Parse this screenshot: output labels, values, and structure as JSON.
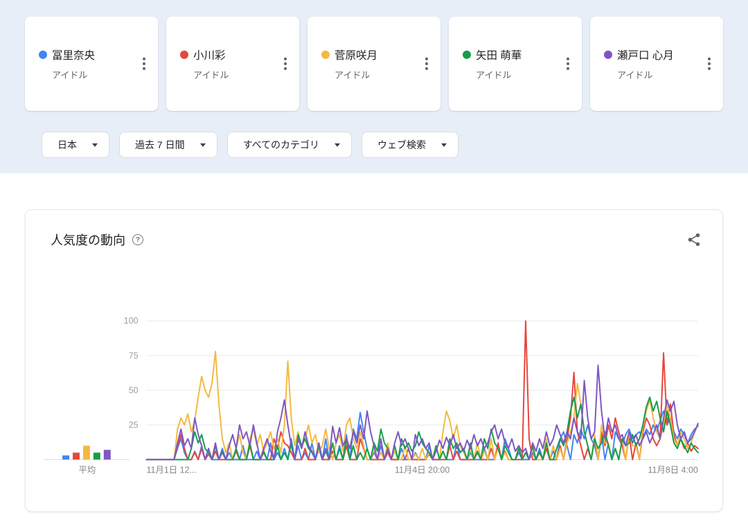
{
  "cards": [
    {
      "name": "冨里奈央",
      "type": "アイドル",
      "color": "#4285f4"
    },
    {
      "name": "小川彩",
      "type": "アイドル",
      "color": "#e8453c"
    },
    {
      "name": "菅原咲月",
      "type": "アイドル",
      "color": "#f4b942"
    },
    {
      "name": "矢田 萌華",
      "type": "アイドル",
      "color": "#149e4c"
    },
    {
      "name": "瀬戸口 心月",
      "type": "アイドル",
      "color": "#7e57c2"
    }
  ],
  "filters": [
    {
      "id": "region",
      "label": "日本"
    },
    {
      "id": "time-range",
      "label": "過去 7 日間"
    },
    {
      "id": "category",
      "label": "すべてのカテゴリ"
    },
    {
      "id": "search-type",
      "label": "ウェブ検索"
    }
  ],
  "chart_data": {
    "type": "line",
    "title": "人気度の動向",
    "help_glyph": "?",
    "avg_label": "平均",
    "y_ticks": [
      100,
      75,
      50,
      25
    ],
    "ylim": [
      0,
      100
    ],
    "x_labels": [
      "11月1日 12...",
      "11月4日 20:00",
      "11月8日 4:00"
    ],
    "grid": true,
    "series": [
      {
        "name": "冨里奈央",
        "color": "#4285f4",
        "average": 3,
        "values": [
          0,
          0,
          0,
          0,
          0,
          0,
          0,
          0,
          0,
          8,
          15,
          5,
          0,
          0,
          6,
          0,
          10,
          0,
          4,
          0,
          0,
          0,
          8,
          0,
          5,
          0,
          0,
          0,
          10,
          0,
          0,
          0,
          6,
          0,
          0,
          0,
          12,
          0,
          5,
          0,
          8,
          0,
          15,
          0,
          10,
          0,
          5,
          0,
          12,
          0,
          8,
          0,
          15,
          0,
          6,
          0,
          10,
          0,
          18,
          0,
          22,
          15,
          34,
          20,
          8,
          0,
          5,
          0,
          10,
          0,
          6,
          0,
          0,
          0,
          8,
          0,
          0,
          0,
          5,
          0,
          0,
          0,
          10,
          0,
          0,
          0,
          6,
          0,
          0,
          0,
          12,
          0,
          0,
          0,
          5,
          0,
          0,
          0,
          8,
          0,
          0,
          0,
          10,
          0,
          15,
          8,
          0,
          0,
          5,
          0,
          0,
          0,
          5,
          0,
          8,
          0,
          12,
          0,
          6,
          0,
          15,
          20,
          10,
          0,
          18,
          12,
          22,
          15,
          25,
          15,
          10,
          0,
          18,
          0,
          12,
          0,
          20,
          15,
          10,
          18,
          22,
          15,
          18,
          20,
          16,
          22,
          18,
          25,
          20,
          28,
          35,
          25,
          30,
          20,
          15,
          22,
          18,
          12,
          18,
          22,
          24
        ]
      },
      {
        "name": "小川彩",
        "color": "#e8453c",
        "average": 5,
        "values": [
          0,
          0,
          0,
          0,
          0,
          0,
          0,
          0,
          0,
          10,
          18,
          8,
          0,
          0,
          5,
          0,
          8,
          0,
          4,
          0,
          6,
          0,
          0,
          0,
          0,
          0,
          6,
          0,
          0,
          0,
          10,
          0,
          0,
          0,
          5,
          0,
          0,
          15,
          8,
          20,
          12,
          10,
          5,
          0,
          0,
          0,
          8,
          0,
          0,
          0,
          12,
          0,
          0,
          0,
          6,
          0,
          0,
          0,
          10,
          0,
          0,
          0,
          15,
          8,
          0,
          0,
          0,
          0,
          0,
          0,
          5,
          0,
          0,
          0,
          0,
          0,
          8,
          0,
          0,
          0,
          0,
          0,
          4,
          0,
          0,
          0,
          0,
          0,
          10,
          0,
          6,
          0,
          0,
          0,
          0,
          0,
          5,
          0,
          0,
          0,
          8,
          0,
          12,
          0,
          6,
          0,
          0,
          0,
          0,
          0,
          100,
          15,
          0,
          0,
          5,
          0,
          8,
          0,
          0,
          0,
          10,
          0,
          15,
          30,
          63,
          20,
          10,
          0,
          8,
          0,
          15,
          0,
          20,
          10,
          25,
          15,
          30,
          20,
          10,
          0,
          18,
          0,
          12,
          0,
          20,
          30,
          25,
          15,
          10,
          15,
          77,
          25,
          40,
          18,
          10,
          15,
          8,
          12,
          6,
          10,
          8
        ]
      },
      {
        "name": "菅原咲月",
        "color": "#f4b942",
        "average": 10,
        "values": [
          0,
          0,
          0,
          0,
          0,
          0,
          0,
          0,
          0,
          22,
          30,
          25,
          33,
          20,
          28,
          45,
          60,
          50,
          45,
          55,
          78,
          40,
          15,
          5,
          12,
          0,
          8,
          18,
          5,
          0,
          15,
          22,
          10,
          18,
          6,
          12,
          20,
          8,
          15,
          5,
          25,
          71,
          30,
          10,
          20,
          8,
          15,
          25,
          12,
          18,
          5,
          10,
          22,
          8,
          0,
          12,
          18,
          6,
          25,
          30,
          15,
          8,
          20,
          10,
          0,
          0,
          8,
          0,
          5,
          0,
          12,
          0,
          6,
          0,
          0,
          10,
          0,
          0,
          4,
          0,
          8,
          0,
          5,
          0,
          10,
          0,
          20,
          35,
          28,
          15,
          25,
          10,
          5,
          0,
          8,
          0,
          12,
          0,
          6,
          0,
          15,
          0,
          8,
          0,
          5,
          0,
          0,
          0,
          10,
          0,
          5,
          0,
          8,
          0,
          0,
          0,
          15,
          0,
          10,
          0,
          8,
          0,
          12,
          20,
          30,
          55,
          40,
          20,
          10,
          0,
          18,
          0,
          25,
          12,
          12,
          0,
          8,
          0,
          15,
          0,
          20,
          10,
          10,
          0,
          25,
          35,
          43,
          30,
          20,
          15,
          25,
          40,
          30,
          15,
          10,
          20,
          15,
          8,
          12,
          20,
          25
        ]
      },
      {
        "name": "矢田 萌華",
        "color": "#149e4c",
        "average": 5,
        "values": [
          0,
          0,
          0,
          0,
          0,
          0,
          0,
          0,
          0,
          0,
          0,
          0,
          0,
          8,
          20,
          12,
          18,
          8,
          5,
          0,
          10,
          0,
          6,
          0,
          0,
          0,
          8,
          0,
          0,
          0,
          12,
          0,
          0,
          0,
          6,
          0,
          0,
          0,
          10,
          0,
          5,
          0,
          12,
          0,
          18,
          10,
          15,
          8,
          5,
          0,
          10,
          0,
          6,
          0,
          12,
          0,
          8,
          0,
          15,
          0,
          10,
          0,
          5,
          0,
          8,
          0,
          12,
          6,
          22,
          12,
          8,
          0,
          10,
          0,
          15,
          8,
          12,
          6,
          10,
          20,
          12,
          8,
          5,
          0,
          10,
          0,
          6,
          0,
          15,
          8,
          12,
          5,
          8,
          0,
          12,
          0,
          6,
          0,
          15,
          8,
          22,
          12,
          8,
          0,
          10,
          5,
          0,
          0,
          8,
          0,
          5,
          0,
          10,
          0,
          6,
          0,
          12,
          0,
          0,
          8,
          15,
          10,
          20,
          35,
          45,
          30,
          40,
          20,
          10,
          0,
          15,
          8,
          12,
          20,
          10,
          0,
          8,
          0,
          15,
          10,
          12,
          18,
          10,
          15,
          25,
          38,
          45,
          35,
          42,
          30,
          20,
          35,
          25,
          12,
          8,
          15,
          10,
          5,
          12,
          8,
          5
        ]
      },
      {
        "name": "瀬戸口 心月",
        "color": "#7e57c2",
        "average": 7,
        "values": [
          0,
          0,
          0,
          0,
          0,
          0,
          0,
          0,
          0,
          12,
          22,
          10,
          15,
          8,
          30,
          18,
          10,
          0,
          8,
          0,
          12,
          0,
          5,
          0,
          10,
          18,
          8,
          25,
          15,
          20,
          10,
          25,
          12,
          0,
          8,
          15,
          6,
          0,
          20,
          30,
          43,
          25,
          10,
          0,
          15,
          8,
          20,
          10,
          6,
          0,
          12,
          0,
          8,
          0,
          24,
          12,
          23,
          10,
          15,
          8,
          20,
          12,
          25,
          15,
          35,
          20,
          10,
          0,
          15,
          0,
          8,
          0,
          12,
          20,
          10,
          15,
          8,
          0,
          18,
          10,
          15,
          8,
          12,
          0,
          6,
          14,
          8,
          16,
          10,
          18,
          8,
          12,
          6,
          14,
          8,
          18,
          10,
          15,
          8,
          12,
          20,
          25,
          15,
          22,
          12,
          8,
          15,
          6,
          10,
          5,
          8,
          0,
          12,
          6,
          15,
          8,
          20,
          10,
          15,
          25,
          18,
          12,
          20,
          15,
          30,
          20,
          15,
          57,
          30,
          15,
          20,
          68,
          35,
          15,
          30,
          20,
          25,
          15,
          18,
          10,
          20,
          12,
          18,
          10,
          15,
          20,
          12,
          18,
          25,
          15,
          30,
          43,
          35,
          42,
          25,
          15,
          20,
          12,
          15,
          20,
          26
        ]
      }
    ]
  }
}
